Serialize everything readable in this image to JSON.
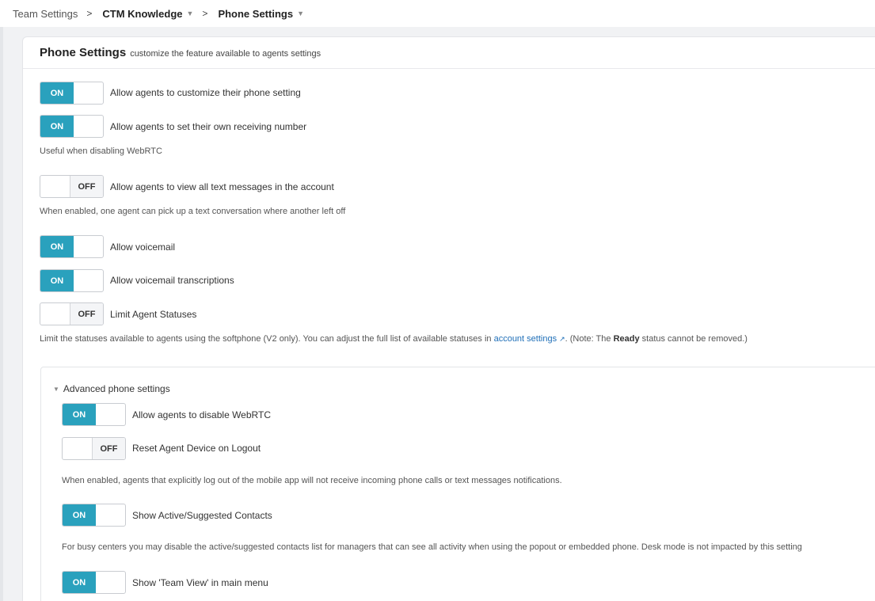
{
  "breadcrumb": {
    "items": [
      {
        "label": "Team Settings"
      },
      {
        "label": "CTM Knowledge"
      },
      {
        "label": "Phone Settings"
      }
    ],
    "separator": ">"
  },
  "card": {
    "title": "Phone Settings",
    "subtitle": "customize the feature available to agents settings"
  },
  "toggle_text": {
    "on": "ON",
    "off": "OFF"
  },
  "settings": [
    {
      "state": "on",
      "label": "Allow agents to customize their phone setting",
      "help": ""
    },
    {
      "state": "on",
      "label": "Allow agents to set their own receiving number",
      "help": "Useful when disabling WebRTC"
    },
    {
      "state": "off",
      "label": "Allow agents to view all text messages in the account",
      "help": "When enabled, one agent can pick up a text conversation where another left off"
    },
    {
      "state": "on",
      "label": "Allow voicemail",
      "help": ""
    },
    {
      "state": "on",
      "label": "Allow voicemail transcriptions",
      "help": ""
    },
    {
      "state": "off",
      "label": "Limit Agent Statuses",
      "help": ""
    }
  ],
  "limit_help": {
    "before": "Limit the statuses available to agents using the softphone (V2 only). You can adjust the full list of available statuses in ",
    "link": "account settings",
    "middle": ". (Note: The ",
    "bold": "Ready",
    "after": " status cannot be removed.)"
  },
  "advanced": {
    "title": "Advanced phone settings",
    "settings": [
      {
        "state": "on",
        "label": "Allow agents to disable WebRTC",
        "help": ""
      },
      {
        "state": "off",
        "label": "Reset Agent Device on Logout",
        "help": "When enabled, agents that explicitly log out of the mobile app will not receive incoming phone calls or text messages notifications."
      },
      {
        "state": "on",
        "label": "Show Active/Suggested Contacts",
        "help": "For busy centers you may disable the active/suggested contacts list for managers that can see all activity when using the popout or embedded phone. Desk mode is not impacted by this setting"
      },
      {
        "state": "on",
        "label": "Show 'Team View' in main menu",
        "help": ""
      }
    ]
  },
  "colors": {
    "accent": "#2aa1bd",
    "link": "#1f6fb8"
  }
}
